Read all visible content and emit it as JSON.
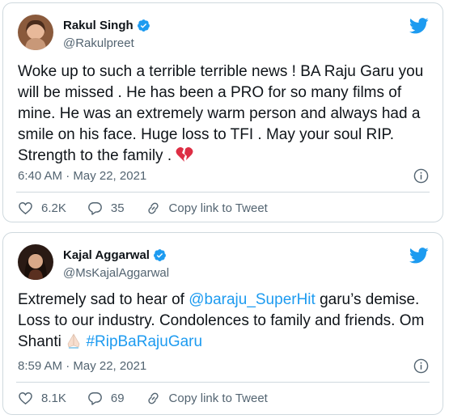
{
  "tweets": [
    {
      "name": "Rakul Singh",
      "handle": "@Rakulpreet",
      "text_part1": "Woke up to such a terrible terrible news ! BA Raju Garu you will be missed . He has been a PRO for so many films of mine. He was an extremely warm person and always had a smile on his face. Huge loss to TFI . May your soul RIP. Strength to the family . ",
      "emoji": "broken-heart",
      "timestamp": "6:40 AM · May 22, 2021",
      "likes": "6.2K",
      "replies": "35",
      "copy_link": "Copy link to Tweet"
    },
    {
      "name": "Kajal Aggarwal",
      "handle": "@MsKajalAggarwal",
      "text_before_mention": "Extremely sad to hear of ",
      "mention": "@baraju_SuperHit",
      "text_after_mention": " garu’s demise. Loss to our industry. Condolences to family and friends. Om Shanti ",
      "emoji": "folded-hands",
      "hashtag": "#RipBaRajuGaru",
      "timestamp": "8:59 AM · May 22, 2021",
      "likes": "8.1K",
      "replies": "69",
      "copy_link": "Copy link to Tweet"
    }
  ],
  "colors": {
    "link": "#1d9bf0",
    "text": "#0f1419",
    "secondary": "#536471",
    "border": "#cfd9de"
  }
}
